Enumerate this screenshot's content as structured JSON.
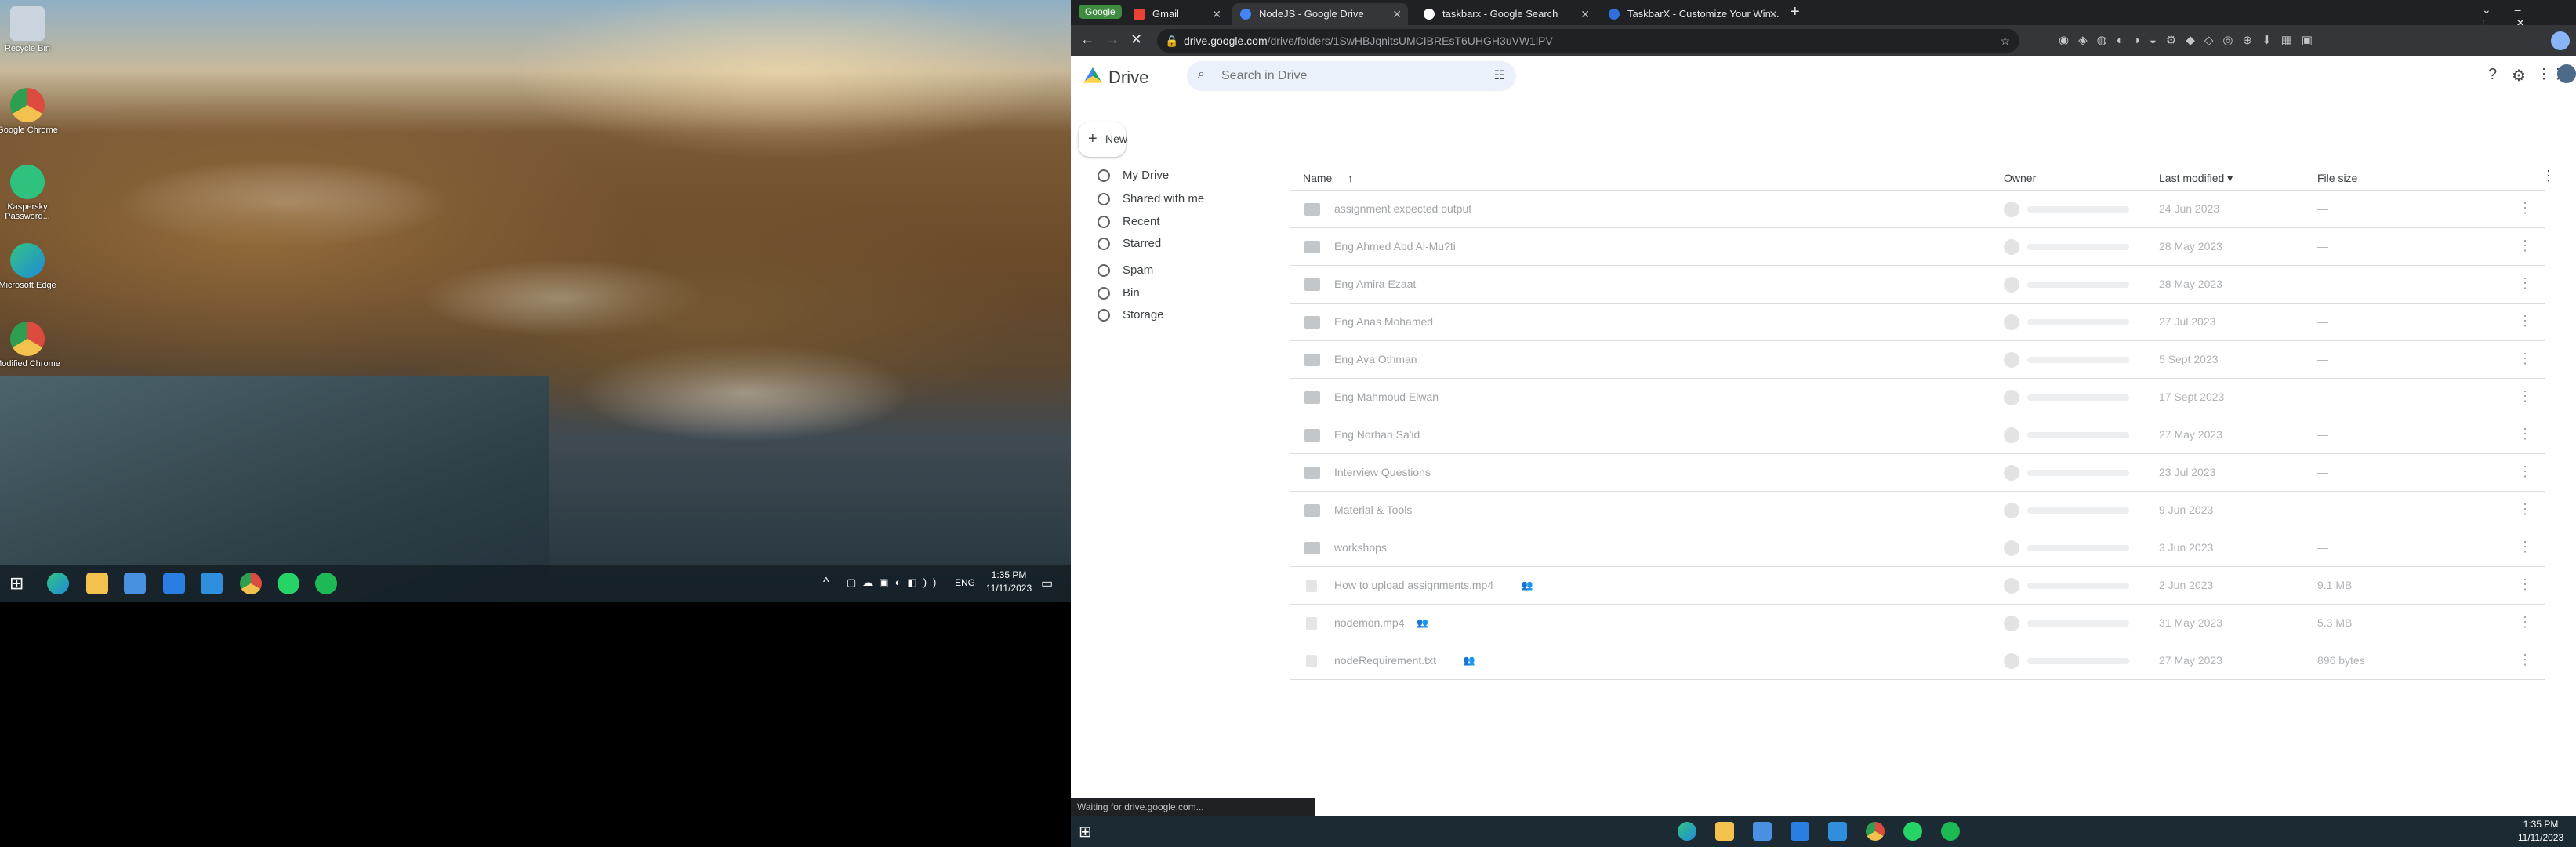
{
  "desktop": {
    "icons": [
      {
        "label": "Recycle Bin",
        "icon": "recycle-bin-icon",
        "color": "#c9d4de"
      },
      {
        "label": "Google Chrome",
        "icon": "chrome-icon",
        "color": "#dd4b3e"
      },
      {
        "label": "Kaspersky Password...",
        "icon": "password-manager-icon",
        "color": "#2ec27e"
      },
      {
        "label": "Microsoft Edge",
        "icon": "edge-icon",
        "color": "#1e8bd9"
      },
      {
        "label": "Modified Chrome",
        "icon": "chrome-icon",
        "color": "#e0a31c"
      }
    ]
  },
  "left_taskbar": {
    "apps": [
      {
        "icon": "windows-start-icon",
        "color": "#ffffff"
      },
      {
        "icon": "edge-icon",
        "color": "#1e8bd9"
      },
      {
        "icon": "file-explorer-icon",
        "color": "#f2c14e"
      },
      {
        "icon": "store-icon",
        "color": "#4a90e2"
      },
      {
        "icon": "mail-icon",
        "color": "#2a7de1"
      },
      {
        "icon": "vscode-icon",
        "color": "#2f8fdd"
      },
      {
        "icon": "chrome-icon",
        "color": "#dd4b3e"
      },
      {
        "icon": "whatsapp-icon",
        "color": "#25d366"
      },
      {
        "icon": "spotify-icon",
        "color": "#1db954"
      }
    ],
    "lang": "ENG",
    "time": "1:35 PM",
    "date": "11/11/2023"
  },
  "browser": {
    "tab_group": "Google",
    "tabs": [
      {
        "title": "Gmail",
        "color": "#ea4335"
      },
      {
        "title": "NodeJS - Google Drive",
        "color": "#4285f4"
      },
      {
        "title": "taskbarx - Google Search",
        "color": "#ffffff"
      },
      {
        "title": "TaskbarX - Customize Your Win...",
        "color": "#2f6fde"
      }
    ],
    "url_host": "drive.google.com",
    "url_path": "/drive/folders/1SwHBJqnitsUMCIBREsT6UHGH3uVW1lPV",
    "status": "Waiting for drive.google.com..."
  },
  "drive": {
    "brand": "Drive",
    "search_placeholder": "Search in Drive",
    "new_label": "New",
    "nav": [
      {
        "label": "My Drive",
        "icon": "my-drive-icon"
      },
      {
        "label": "Shared with me",
        "icon": "shared-icon"
      },
      {
        "label": "Recent",
        "icon": "clock-icon"
      },
      {
        "label": "Starred",
        "icon": "star-icon"
      },
      {
        "label": "Spam",
        "icon": "spam-icon"
      },
      {
        "label": "Bin",
        "icon": "bin-icon"
      },
      {
        "label": "Storage",
        "icon": "cloud-icon"
      }
    ],
    "columns": {
      "name": "Name",
      "owner": "Owner",
      "modified": "Last modified",
      "size": "File size"
    },
    "rows": [
      {
        "name": "assignment expected output",
        "date": "24 Jun 2023",
        "size": "—",
        "type": "folder",
        "shared": false
      },
      {
        "name": "Eng Ahmed Abd Al-Mu?ti",
        "date": "28 May 2023",
        "size": "—",
        "type": "folder",
        "shared": false
      },
      {
        "name": "Eng Amira Ezaat",
        "date": "28 May 2023",
        "size": "—",
        "type": "folder",
        "shared": false
      },
      {
        "name": "Eng Anas Mohamed",
        "date": "27 Jul 2023",
        "size": "—",
        "type": "folder",
        "shared": false
      },
      {
        "name": "Eng Aya Othman",
        "date": "5 Sept 2023",
        "size": "—",
        "type": "folder",
        "shared": false
      },
      {
        "name": "Eng Mahmoud Elwan",
        "date": "17 Sept 2023",
        "size": "—",
        "type": "folder",
        "shared": false
      },
      {
        "name": "Eng Norhan Sa'id",
        "date": "27 May 2023",
        "size": "—",
        "type": "folder",
        "shared": false
      },
      {
        "name": "Interview Questions",
        "date": "23 Jul 2023",
        "size": "—",
        "type": "folder",
        "shared": false
      },
      {
        "name": "Material & Tools",
        "date": "9 Jun 2023",
        "size": "—",
        "type": "folder",
        "shared": false
      },
      {
        "name": "workshops",
        "date": "3 Jun 2023",
        "size": "—",
        "type": "folder",
        "shared": false
      },
      {
        "name": "How to upload assignments.mp4",
        "date": "2 Jun 2023",
        "size": "9.1 MB",
        "type": "file",
        "shared": true
      },
      {
        "name": "nodemon.mp4",
        "date": "31 May 2023",
        "size": "5.3 MB",
        "type": "file",
        "shared": true
      },
      {
        "name": "nodeRequirement.txt",
        "date": "27 May 2023",
        "size": "896 bytes",
        "type": "file",
        "shared": true
      }
    ]
  },
  "right_taskbar": {
    "apps": [
      {
        "icon": "edge-icon",
        "color": "#1e8bd9"
      },
      {
        "icon": "file-explorer-icon",
        "color": "#f2c14e"
      },
      {
        "icon": "store-icon",
        "color": "#4a90e2"
      },
      {
        "icon": "mail-icon",
        "color": "#2a7de1"
      },
      {
        "icon": "vscode-icon",
        "color": "#2f8fdd"
      },
      {
        "icon": "chrome-icon",
        "color": "#dd4b3e"
      },
      {
        "icon": "whatsapp-icon",
        "color": "#25d366"
      },
      {
        "icon": "spotify-icon",
        "color": "#1db954"
      }
    ],
    "time": "1:35 PM",
    "date": "11/11/2023"
  }
}
